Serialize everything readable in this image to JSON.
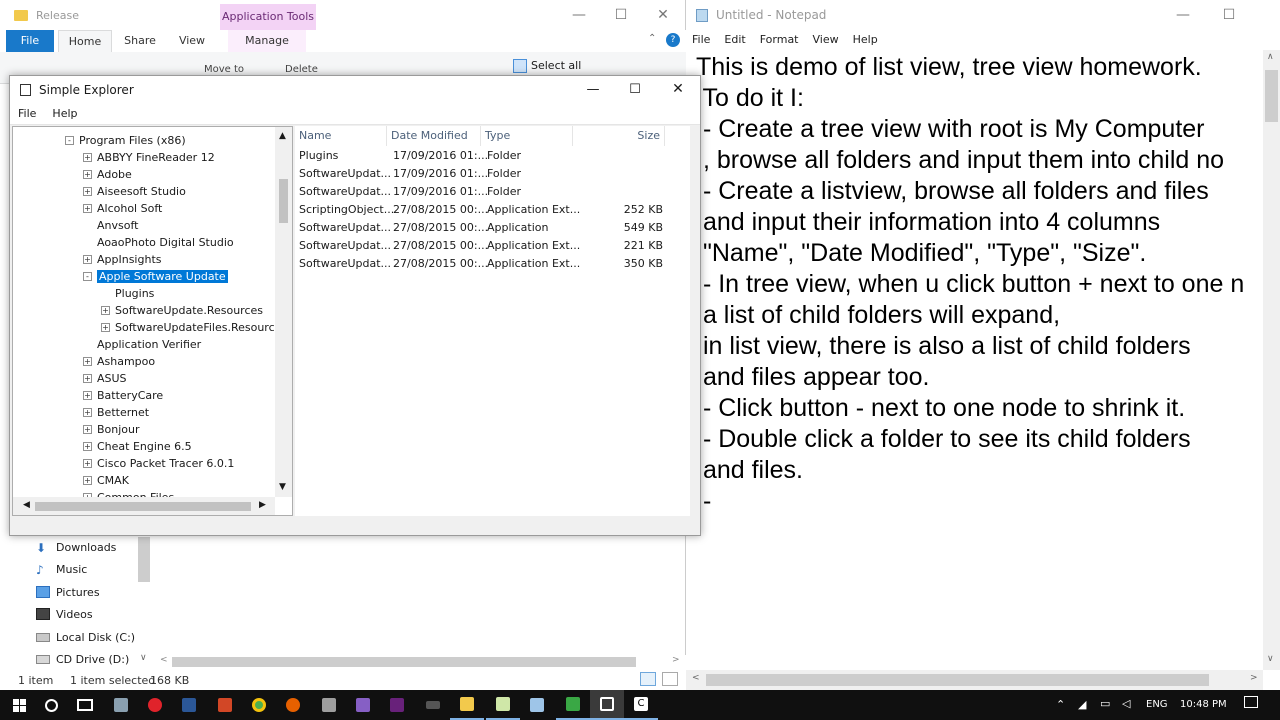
{
  "bg_explorer": {
    "title": "Release",
    "context_tab": "Application Tools",
    "tabs": [
      "File",
      "Home",
      "Share",
      "View",
      "Manage"
    ],
    "ribbon_visible": [
      "Move to",
      "Delete",
      "Select all"
    ],
    "nav_items": [
      {
        "label": "Downloads",
        "icon": "download-icon"
      },
      {
        "label": "Music",
        "icon": "music-icon"
      },
      {
        "label": "Pictures",
        "icon": "pictures-icon"
      },
      {
        "label": "Videos",
        "icon": "video-icon"
      },
      {
        "label": "Local Disk (C:)",
        "icon": "drive-icon"
      },
      {
        "label": "CD Drive (D:)",
        "icon": "cd-drive-icon"
      }
    ],
    "status_items": "1 item",
    "status_selected": "1 item selected",
    "status_size": "168 KB"
  },
  "dialog": {
    "title": "Simple Explorer",
    "menu": [
      "File",
      "Help"
    ],
    "tree": [
      {
        "label": "Program Files (x86)",
        "expander": "-",
        "level": 0
      },
      {
        "label": "ABBYY FineReader 12",
        "expander": "+",
        "level": 1
      },
      {
        "label": "Adobe",
        "expander": "+",
        "level": 1
      },
      {
        "label": "Aiseesoft Studio",
        "expander": "+",
        "level": 1
      },
      {
        "label": "Alcohol Soft",
        "expander": "+",
        "level": 1
      },
      {
        "label": "Anvsoft",
        "expander": "",
        "level": 1
      },
      {
        "label": "AoaoPhoto Digital Studio",
        "expander": "",
        "level": 1
      },
      {
        "label": "AppInsights",
        "expander": "+",
        "level": 1
      },
      {
        "label": "Apple Software Update",
        "expander": "-",
        "level": 1,
        "selected": true
      },
      {
        "label": "Plugins",
        "expander": "",
        "level": 2
      },
      {
        "label": "SoftwareUpdate.Resources",
        "expander": "+",
        "level": 2
      },
      {
        "label": "SoftwareUpdateFiles.Resources",
        "expander": "+",
        "level": 2
      },
      {
        "label": "Application Verifier",
        "expander": "",
        "level": 1
      },
      {
        "label": "Ashampoo",
        "expander": "+",
        "level": 1
      },
      {
        "label": "ASUS",
        "expander": "+",
        "level": 1
      },
      {
        "label": "BatteryCare",
        "expander": "+",
        "level": 1
      },
      {
        "label": "Betternet",
        "expander": "+",
        "level": 1
      },
      {
        "label": "Bonjour",
        "expander": "+",
        "level": 1
      },
      {
        "label": "Cheat Engine 6.5",
        "expander": "+",
        "level": 1
      },
      {
        "label": "Cisco Packet Tracer 6.0.1",
        "expander": "+",
        "level": 1
      },
      {
        "label": "CMAK",
        "expander": "+",
        "level": 1
      },
      {
        "label": "Common Files",
        "expander": "+",
        "level": 1
      }
    ],
    "list_headers": [
      "Name",
      "Date Modified",
      "Type",
      "Size"
    ],
    "list_rows": [
      [
        "Plugins",
        "17/09/2016 01:...",
        "Folder",
        ""
      ],
      [
        "SoftwareUpdat...",
        "17/09/2016 01:...",
        "Folder",
        ""
      ],
      [
        "SoftwareUpdat...",
        "17/09/2016 01:...",
        "Folder",
        ""
      ],
      [
        "ScriptingObject...",
        "27/08/2015 00:...",
        "Application Ext...",
        "252 KB"
      ],
      [
        "SoftwareUpdat...",
        "27/08/2015 00:...",
        "Application",
        "549 KB"
      ],
      [
        "SoftwareUpdat...",
        "27/08/2015 00:...",
        "Application Ext...",
        "221 KB"
      ],
      [
        "SoftwareUpdat...",
        "27/08/2015 00:...",
        "Application Ext...",
        "350 KB"
      ]
    ]
  },
  "notepad": {
    "title": "Untitled - Notepad",
    "menu": [
      "File",
      "Edit",
      "Format",
      "View",
      "Help"
    ],
    "lines": [
      "This is demo of list view, tree view homework.",
      " To do it I:",
      " - Create a tree view with root is My Computer",
      " , browse all folders and input them into child no",
      " - Create a listview, browse all folders and files",
      " and input their information into 4 columns",
      " \"Name\", \"Date Modified\", \"Type\", \"Size\".",
      " - In tree view, when u click button + next to one n",
      " a list of child folders will expand,",
      " in list view, there is also a list of child folders",
      " and files appear too.",
      " - Click button - next to one node to shrink it.",
      " - Double click a folder to see its child folders",
      " and files.",
      " -"
    ]
  },
  "taskbar": {
    "language": "ENG",
    "time": "10:48 PM"
  }
}
